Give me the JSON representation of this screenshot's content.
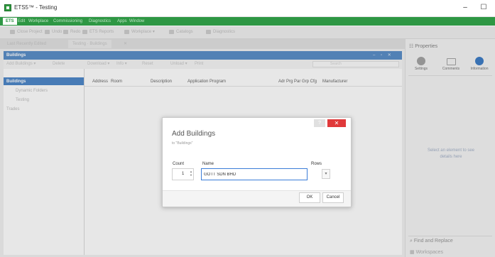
{
  "window": {
    "title": "ETS5™ - Testing",
    "minimize": "–",
    "maximize": "☐"
  },
  "menu": {
    "ets": "ETS",
    "items": [
      "Edit",
      "Workplace",
      "Commissioning",
      "Diagnostics",
      "Apps",
      "Window"
    ]
  },
  "toolbar": {
    "items": [
      "Close Project",
      "Undo",
      "Redo",
      "ETS Reports",
      "Workplace ▾",
      "Catalogs",
      "Diagnostics"
    ]
  },
  "tabs": [
    "Last Recently Edited",
    "Testing · Buildings"
  ],
  "panel": {
    "title": "Buildings",
    "toolbar": [
      "Add Buildings ▾",
      "Delete",
      "Download ▾",
      "Info ▾",
      "Reset",
      "Unload ▾",
      "Print"
    ],
    "search_placeholder": "Search",
    "tree": [
      "Buildings",
      "Dynamic Folders",
      "Testing",
      "Trades"
    ],
    "columns": [
      "Address",
      "Room",
      "Description",
      "Application Program",
      "Adr Prg Par Grp Cfg",
      "Manufacturer"
    ]
  },
  "properties": {
    "title": "Properties",
    "tabs": [
      "Settings",
      "Comments",
      "Information"
    ],
    "empty_text": "Select an element to see details here",
    "find_replace": "Find and Replace",
    "workspaces": "Workspaces"
  },
  "dialog": {
    "title": "Add Buildings",
    "subtitle": "to \"Buildings\"",
    "count_label": "Count",
    "name_label": "Name",
    "rows_label": "Rows",
    "count_value": "1",
    "name_value": "GOTT SDN BHD",
    "ok": "OK",
    "cancel": "Cancel",
    "help": "?",
    "close": "✕"
  },
  "colors": {
    "menu_green": "#2e9744",
    "panel_blue": "#4a83c3",
    "close_red": "#e0393a",
    "info_blue": "#2a6fc0"
  }
}
